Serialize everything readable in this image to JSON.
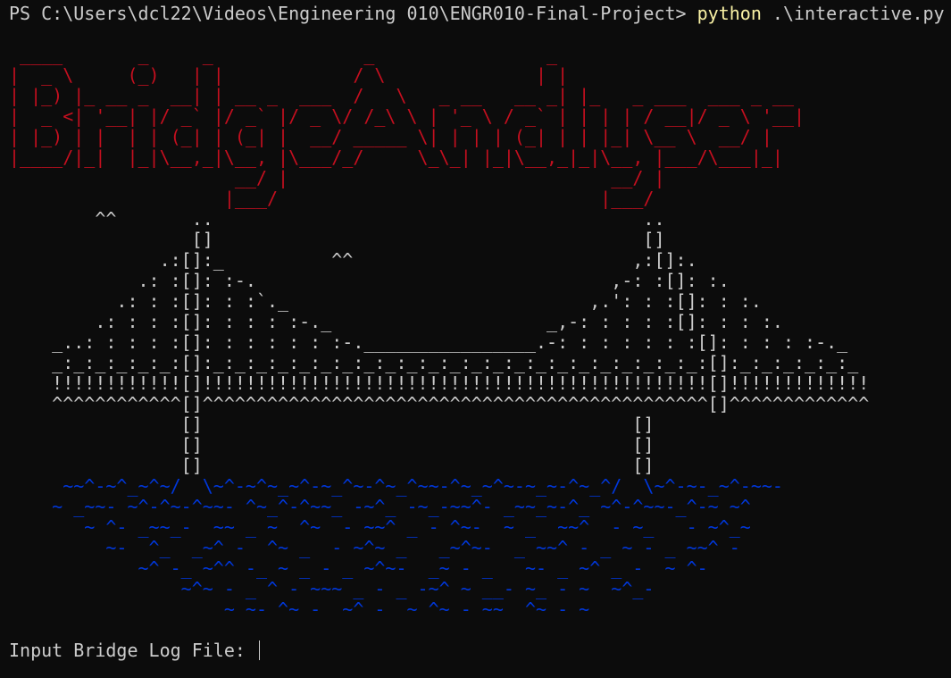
{
  "prompt": {
    "path": "PS C:\\Users\\dcl22\\Videos\\Engineering 010\\ENGR010-Final-Project> ",
    "command": "python",
    "args": " .\\interactive.py"
  },
  "banner_text": "Bridge Analyser",
  "banner_art": " ____       _     _              _                _\n|  _ \\     (_)   | |            / \\              | |\n| |_) |_ __ _  __| | __ _  ___  /   \\   _ __   __ _| |_   _ ___  ___ _ __\n|  _ <| '__| |/ _` |/ _` |/ _ \\/ /_\\ \\ | '_ \\ / _` | | | | / __|/ _ \\ '__|\n| |_) | |  | | (_| | (_| |  __/ _____ \\| | | | (_| | | |_| \\__ \\  __/ |\n|____/|_|  |_|\\__,_|\\__, |\\___/_/     \\_\\_| |_|\\__,_|_|\\__, |___/\\___|_|\n                     __/ |                              __/ |\n                    |___/                              |___/",
  "bridge_art": "        ^^       ..                                        ..\n                 []                                        []\n              .:[]:_          ^^                          ,:[]:.\n            .: :[]: :-.                                 ,-: :[]: :.\n          .: : :[]: : :`._                            ,.': : :[]: : :.\n        .: : : :[]: : : : :-._                    _,-: : : : :[]: : : :.\n    _..: : : : :[]: : : : : : :-.________________.-: : : : : : :[]: : : : :-._\n    _:_:_:_:_:_:[]:_:_:_:_:_:_:_:_:_:_:_:_:_:_:_:_:_:_:_:_:_:_:_:[]:_:_:_:_:_:_\n    !!!!!!!!!!!![]!!!!!!!!!!!!!!!!!!!!!!!!!!!!!!!!!!!!!!!!!!!!!!![]!!!!!!!!!!!!!\n    ^^^^^^^^^^^^[]^^^^^^^^^^^^^^^^^^^^^^^^^^^^^^^^^^^^^^^^^^^^^^^[]^^^^^^^^^^^^^\n                []                                        []\n                []                                        []\n                []                                        []",
  "water_art": "     ~~^-~^_~^~/  \\~^-~^~_~^-~_^~-^~_^~~-^~_~^~-~_~-^~_^/  \\~^-~-_~^-~~-\n    ~ _~~- ~^-^~-^~~- ^~_^-^~~_ -~^_ -~_-~~^- _~~_~-^_ ~^-^~~-_^-~ ~^\n       ~ ^- _~~_-  ~~ _ ~  ^~  - ~~^ _ - ^~-  ~ _  ~~^  - ~_   - ~^_~\n         ~-  ^_  _~^ -  ^~ _  - ~^~ _   _~^~-  _ ~~^ - _ ~ - _ ~~^ -\n            ~^ -_ ~^^ -_ ~ _ - _ ~^~-  _~ - _   ~- _ ~^ _ -  ~ ^-\n                ~^~ - _ ^ - ~~~ _ - _ -~^ ~ __- ~_ - ~  ~^_-\n                    ~ ~- ^~ -  ~^ -  ~ ^~ - ~~  ^~ - ~",
  "input_prompt": "Input Bridge Log File: "
}
